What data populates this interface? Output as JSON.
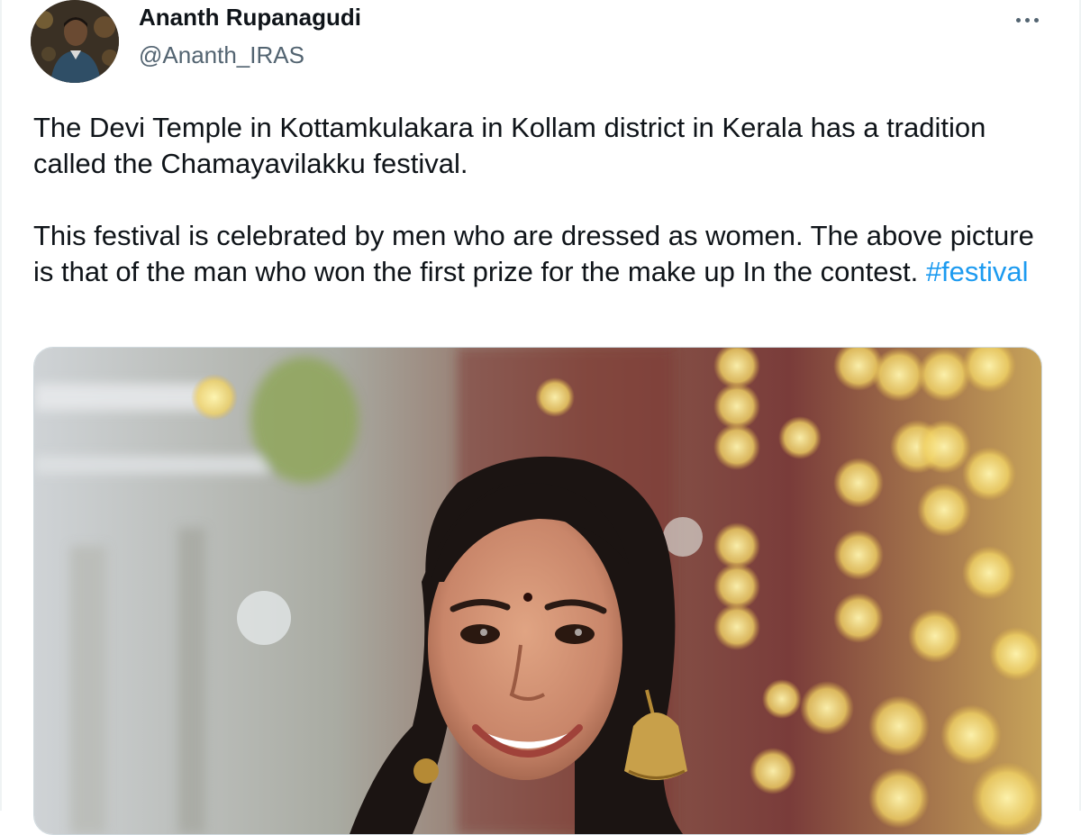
{
  "tweet": {
    "author": {
      "name": "Ananth Rupanagudi",
      "handle": "@Ananth_IRAS",
      "avatar_icon": "profile-photo"
    },
    "more_icon": "more-horizontal-icon",
    "text": {
      "paragraph1": "The Devi Temple in Kottamkulakara in Kollam district in Kerala has a tradition called the Chamayavilakku festival.",
      "paragraph2_before_hashtag": "This festival is celebrated by men who are dressed as women. The above picture is that of the man who won the first prize for the make up In the contest.",
      "hashtag": "#festival"
    },
    "media": {
      "type": "photo"
    }
  },
  "colors": {
    "text": "#0f1419",
    "secondary": "#536471",
    "link": "#1d9bf0",
    "border": "#cfd9de"
  }
}
